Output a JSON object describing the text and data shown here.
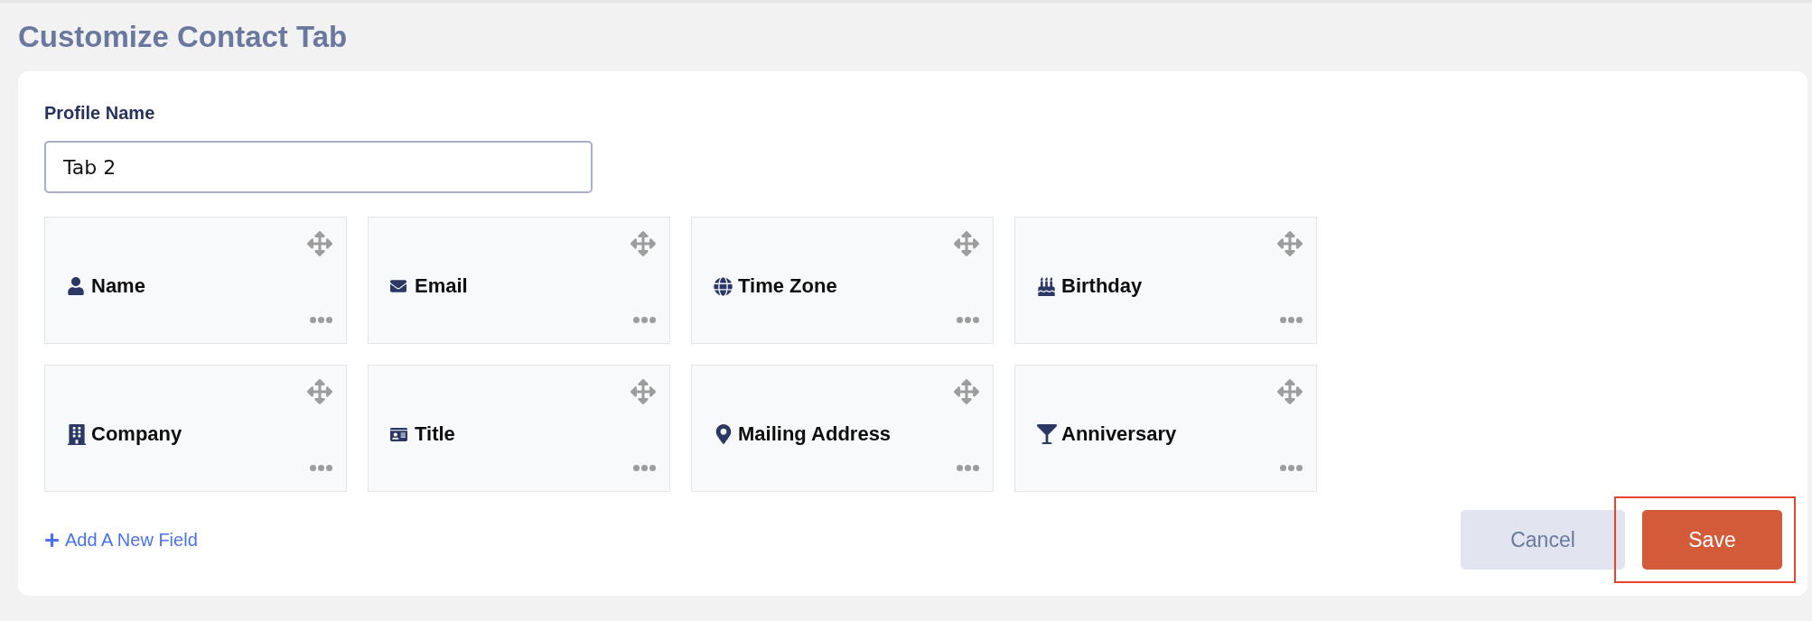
{
  "page": {
    "title": "Customize Contact Tab"
  },
  "profile": {
    "label": "Profile Name",
    "value": "Tab 2"
  },
  "fields": [
    {
      "label": "Name",
      "kind": "name"
    },
    {
      "label": "Email",
      "kind": "email"
    },
    {
      "label": "Time Zone",
      "kind": "timezone"
    },
    {
      "label": "Birthday",
      "kind": "birthday"
    },
    {
      "label": "Company",
      "kind": "company"
    },
    {
      "label": "Title",
      "kind": "title"
    },
    {
      "label": "Mailing Address",
      "kind": "address"
    },
    {
      "label": "Anniversary",
      "kind": "anniversary"
    }
  ],
  "add_field": {
    "label": "Add A New Field"
  },
  "buttons": [
    {
      "label": "Cancel",
      "kind": "secondary",
      "highlighted": false
    },
    {
      "label": "Save",
      "kind": "primary",
      "highlighted": true
    }
  ]
}
